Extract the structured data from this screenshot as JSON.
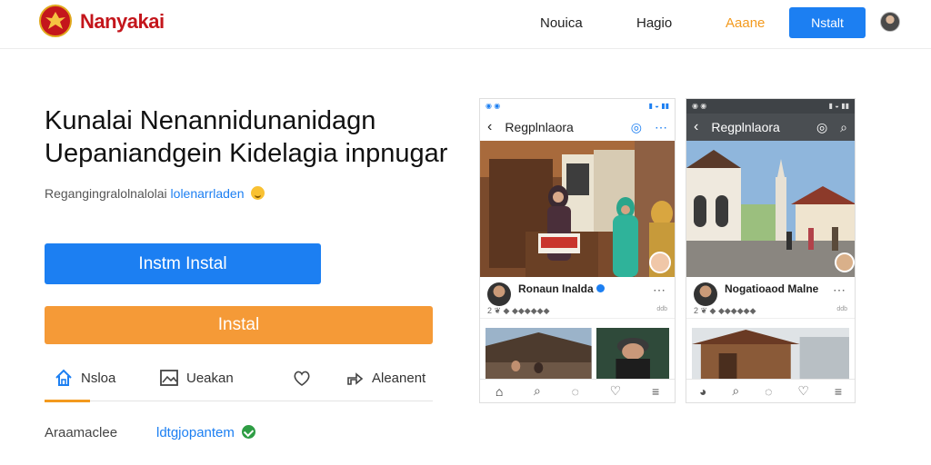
{
  "header": {
    "brand": "Nanyakai",
    "nav": [
      "Nouica",
      "Hagio",
      "Aaane"
    ],
    "cta_label": "Nstalt"
  },
  "hero": {
    "title_line1": "Kunalai Nenannidunanidagn",
    "title_line2": "Uepaniandgein Kidelagia inpnugar",
    "subtitle_text": "Regangingralolnalolai",
    "subtitle_link": "lolenarrladen",
    "primary_button": "Instm Instal",
    "secondary_button": "Instal"
  },
  "tabs": [
    {
      "label": "Nsloa",
      "icon": "home-icon"
    },
    {
      "label": "Ueakan",
      "icon": "image-icon"
    },
    {
      "label": "",
      "icon": "heart-icon"
    },
    {
      "label": "Aleanent",
      "icon": "share-icon"
    }
  ],
  "footer": {
    "label": "Araamaclee",
    "link": "ldtgjopantem"
  },
  "phones": [
    {
      "title": "Regplnlaora",
      "post_name": "Ronaun Inalda",
      "stats": "2 ❦ ◆ ◆◆◆◆◆◆",
      "time": "ddb"
    },
    {
      "title": "Regplnlaora",
      "post_name": "Nogatioaod Malne",
      "stats": "2 ❦ ◆ ◆◆◆◆◆◆",
      "time": "ddb"
    }
  ],
  "colors": {
    "brand_red": "#c4161c",
    "primary_blue": "#1c7ff2",
    "accent_orange": "#f59a37"
  }
}
